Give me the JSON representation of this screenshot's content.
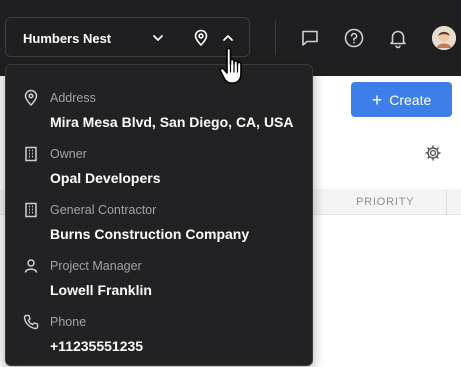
{
  "header": {
    "project_name": "Humbers Nest",
    "icons": [
      "chevron-down-icon",
      "location-pin-icon",
      "chevron-up-icon",
      "chat-icon",
      "help-icon",
      "bell-icon"
    ]
  },
  "toolbar": {
    "create_label": "Create"
  },
  "table": {
    "priority_header": "PRIORITY"
  },
  "project_details": {
    "items": [
      {
        "label": "Address",
        "value": "Mira Mesa Blvd, San Diego, CA, USA",
        "icon": "location-pin-icon"
      },
      {
        "label": "Owner",
        "value": "Opal Developers",
        "icon": "building-icon"
      },
      {
        "label": "General Contractor",
        "value": "Burns Construction Company",
        "icon": "building-icon"
      },
      {
        "label": "Project Manager",
        "value": "Lowell Franklin",
        "icon": "person-icon"
      },
      {
        "label": "Phone",
        "value": "+11235551235",
        "icon": "phone-icon"
      }
    ]
  },
  "colors": {
    "topbar_bg": "#1f1f21",
    "dropdown_bg": "#222224",
    "accent": "#3d7ee8",
    "label_gray": "#a2a2a6"
  }
}
